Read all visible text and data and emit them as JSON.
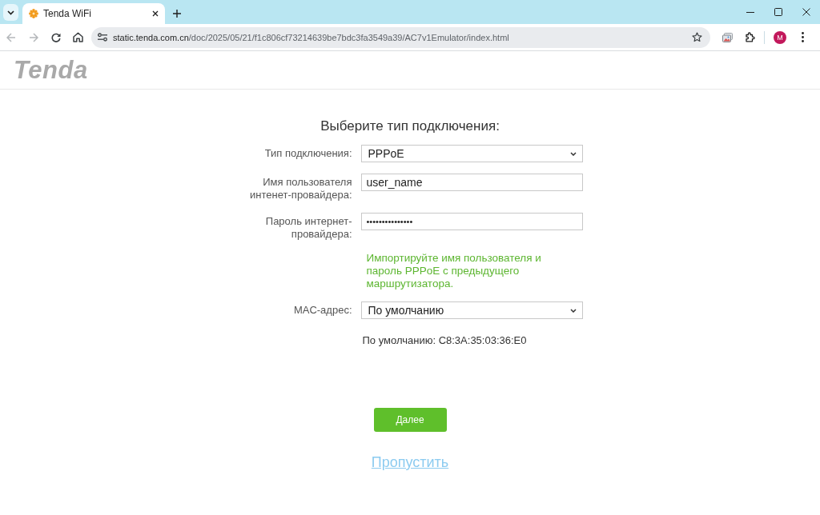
{
  "browser": {
    "tab": {
      "title": "Tenda WiFi",
      "selected": true
    },
    "nav": [
      {
        "kind": "back",
        "disabled": true
      },
      {
        "kind": "forward",
        "disabled": true
      },
      {
        "kind": "reload",
        "disabled": false
      },
      {
        "kind": "home",
        "disabled": false
      }
    ],
    "address": {
      "host": "static.tenda.com.cn",
      "path": "/doc/2025/05/21/f1c806cf73214639be7bdc3fa3549a39/AC7v1Emulator/index.html"
    },
    "profile": {
      "initial": "M"
    }
  },
  "header": {
    "logo": "Tenda"
  },
  "form": {
    "title": "Выберите тип подключения:",
    "fields": [
      {
        "kind": "select",
        "label": "Тип подключения:",
        "value": "PPPoE"
      },
      {
        "kind": "text",
        "label": "Имя пользователя интенет-провайдера:",
        "value": "user_name"
      },
      {
        "kind": "password",
        "label": "Пароль интернет-провайдера:",
        "value": "•••••••••••••••"
      },
      {
        "kind": "note",
        "text": "Импортируйте имя пользователя и пароль PPPoE с предыдущего маршрутизатора."
      },
      {
        "kind": "select",
        "label": "MAC-адрес:",
        "value": "По умолчанию"
      },
      {
        "kind": "info",
        "text": "По умолчанию: C8:3A:35:03:36:E0"
      }
    ],
    "next_button": "Далее",
    "skip_link": "Пропустить"
  }
}
